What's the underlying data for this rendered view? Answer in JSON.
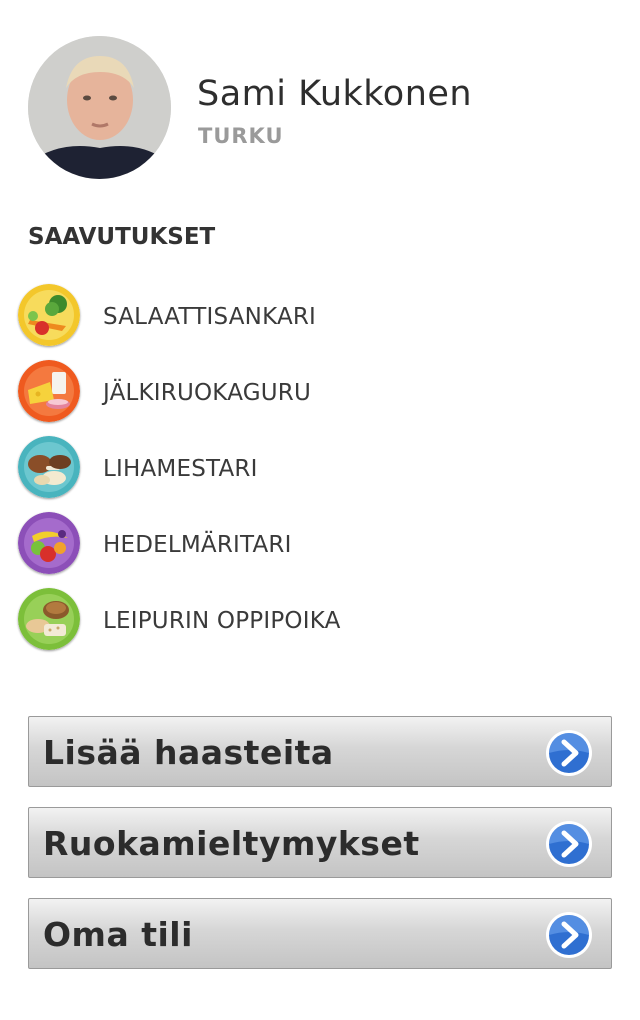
{
  "profile": {
    "name": "Sami Kukkonen",
    "city": "TURKU",
    "avatar_icon": "user-avatar-photo"
  },
  "achievements": {
    "title": "SAAVUTUKSET",
    "items": [
      {
        "label": "SALAATTISANKARI",
        "icon": "salad-icon",
        "color": "#f3c72b"
      },
      {
        "label": "JÄLKIRUOKAGURU",
        "icon": "dessert-icon",
        "color": "#ef5a1f"
      },
      {
        "label": "LIHAMESTARI",
        "icon": "meat-icon",
        "color": "#49b4be"
      },
      {
        "label": "HEDELMÄRITARI",
        "icon": "fruit-icon",
        "color": "#8c4fb8"
      },
      {
        "label": "LEIPURIN OPPIPOIKA",
        "icon": "bread-icon",
        "color": "#7cbf3a"
      }
    ]
  },
  "menu": {
    "items": [
      {
        "label": "Lisää haasteita",
        "icon": "chevron-right-icon"
      },
      {
        "label": "Ruokamieltymykset",
        "icon": "chevron-right-icon"
      },
      {
        "label": "Oma tili",
        "icon": "chevron-right-icon"
      }
    ],
    "accent": "#2f6fd1"
  }
}
